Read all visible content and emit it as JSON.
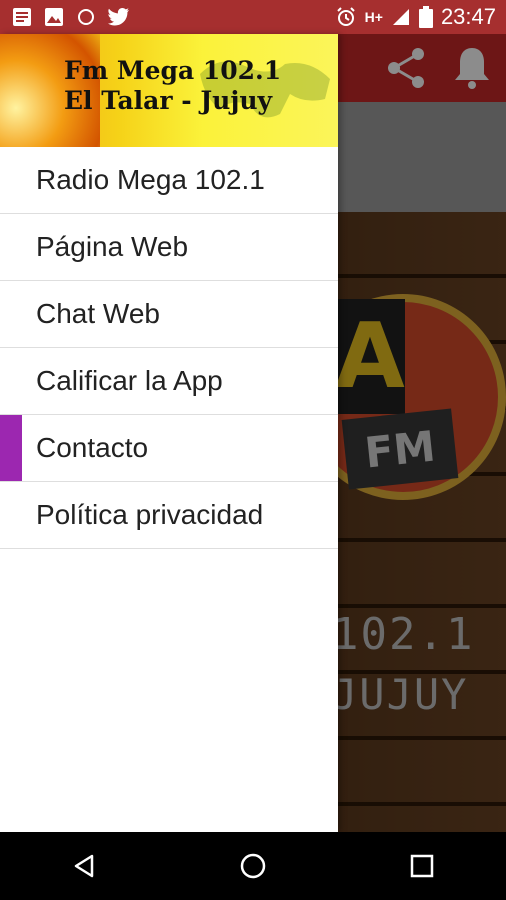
{
  "status_bar": {
    "time": "23:47",
    "network": "H+",
    "left_icons": [
      "notes-icon",
      "image-icon",
      "circle-icon",
      "twitter-icon"
    ],
    "right_icons": [
      "alarm-icon",
      "signal-icon",
      "battery-icon"
    ]
  },
  "drawer": {
    "header": {
      "title_line1": "Fm Mega 102.1",
      "title_line2": "El Talar - Jujuy"
    },
    "items": [
      {
        "label": "Radio Mega 102.1",
        "active": false
      },
      {
        "label": "Página Web",
        "active": false
      },
      {
        "label": "Chat Web",
        "active": false
      },
      {
        "label": "Calificar la App",
        "active": false
      },
      {
        "label": "Contacto",
        "active": true
      },
      {
        "label": "Política privacidad",
        "active": false
      }
    ],
    "accent_color": "#9c27b0"
  },
  "background_app": {
    "toolbar_color": "#c62828",
    "toolbar_icons": [
      "share-icon",
      "bell-icon"
    ],
    "logo_text": "FM",
    "logo_letter": "A",
    "frequency_text": "102.1",
    "city_text": "JUJUY"
  },
  "nav_bar": {
    "buttons": [
      "back-icon",
      "home-icon",
      "recents-icon"
    ]
  }
}
